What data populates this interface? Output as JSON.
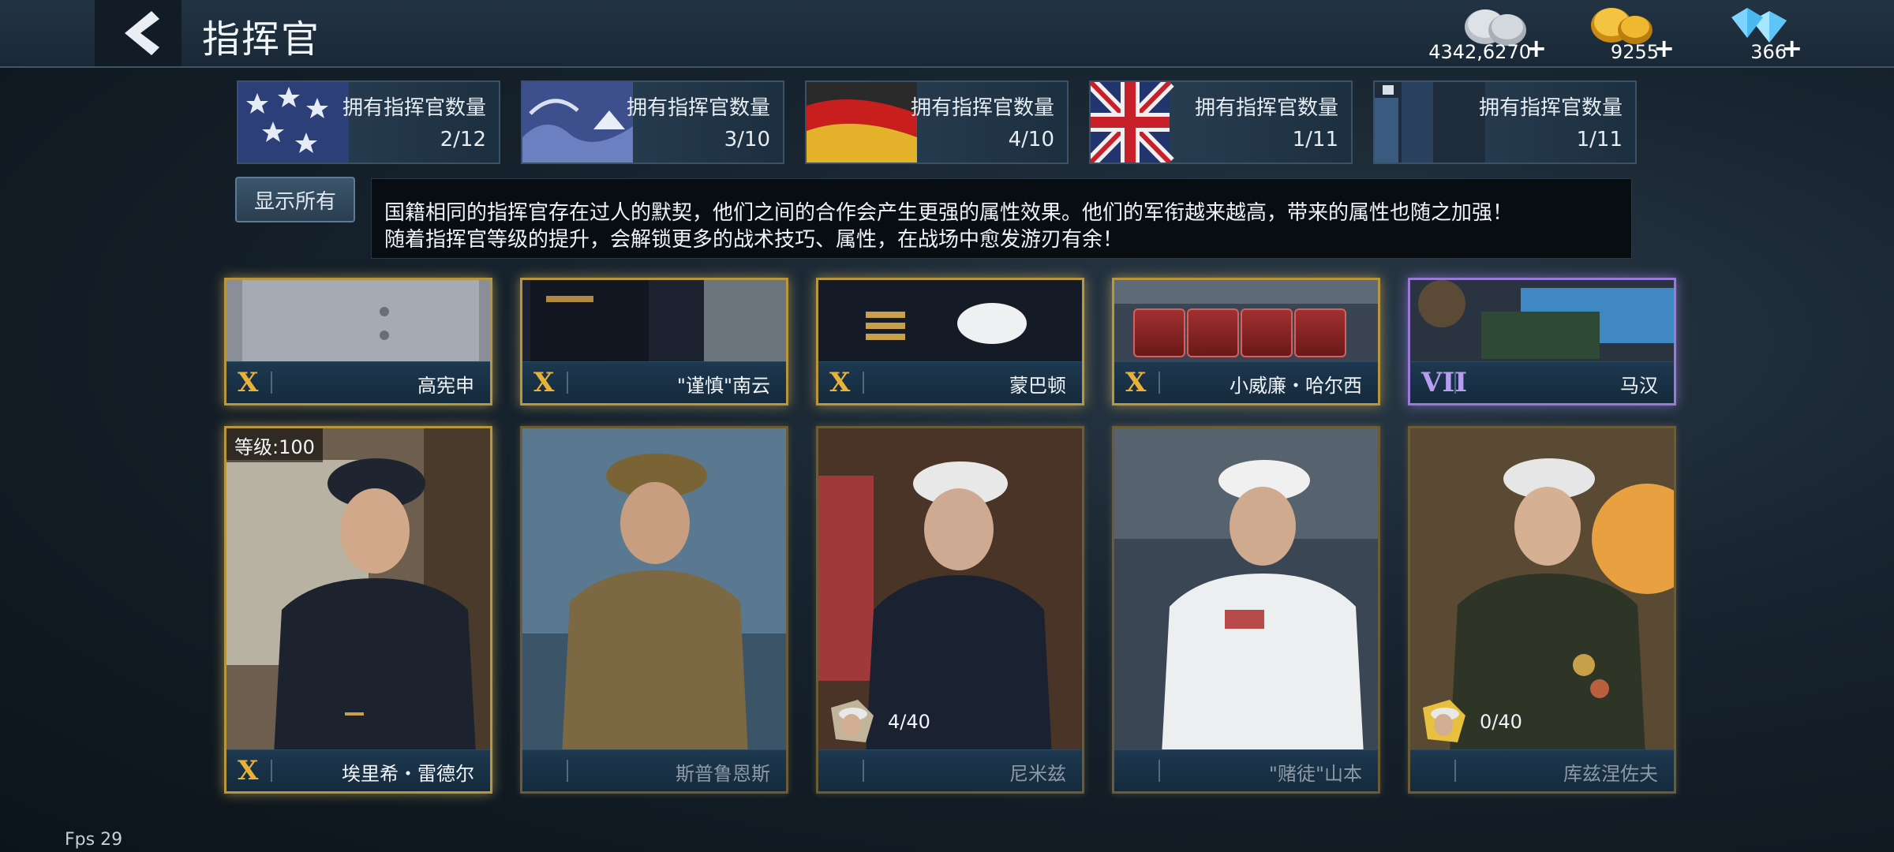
{
  "header": {
    "title": "指挥官",
    "back_icon": "back-arrow-icon"
  },
  "resources": [
    {
      "name": "silver",
      "amount": "4342,6270",
      "plus": "+"
    },
    {
      "name": "gold",
      "amount": "9255",
      "plus": "+"
    },
    {
      "name": "diamond",
      "amount": "366",
      "plus": "+"
    }
  ],
  "nations": [
    {
      "label": "拥有指挥官数量",
      "count": "2/12"
    },
    {
      "label": "拥有指挥官数量",
      "count": "3/10"
    },
    {
      "label": "拥有指挥官数量",
      "count": "4/10"
    },
    {
      "label": "拥有指挥官数量",
      "count": "1/11"
    },
    {
      "label": "拥有指挥官数量",
      "count": "1/11"
    }
  ],
  "show_all_label": "显示所有",
  "info_lines": [
    "国籍相同的指挥官存在过人的默契，他们之间的合作会产生更强的属性效果。他们的军衔越来越高，带来的属性也随之加强！",
    "随着指挥官等级的提升，会解锁更多的战术技巧、属性，在战场中愈发游刃有余！"
  ],
  "top_row": [
    {
      "rank": "X",
      "name": "高宪申"
    },
    {
      "rank": "X",
      "name": "\"谨慎\"南云"
    },
    {
      "rank": "X",
      "name": "蒙巴顿"
    },
    {
      "rank": "X",
      "name": "小威廉・哈尔西"
    },
    {
      "rank": "VII",
      "name": "马汉"
    }
  ],
  "bottom_row": [
    {
      "rank": "X",
      "name": "埃里希・雷德尔",
      "level": "等级:100",
      "owned": true
    },
    {
      "rank": "",
      "name": "斯普鲁恩斯",
      "owned": false
    },
    {
      "rank": "",
      "name": "尼米兹",
      "fragments": "4/40",
      "owned": false
    },
    {
      "rank": "",
      "name": "\"赌徒\"山本",
      "owned": false
    },
    {
      "rank": "",
      "name": "库兹涅佐夫",
      "fragments": "0/40",
      "owned": false
    }
  ],
  "fps": "Fps 29",
  "colors": {
    "gold_frame": "#b8963e",
    "purple_frame": "#9a7ad8",
    "rank_gold": "#e8b23a"
  }
}
